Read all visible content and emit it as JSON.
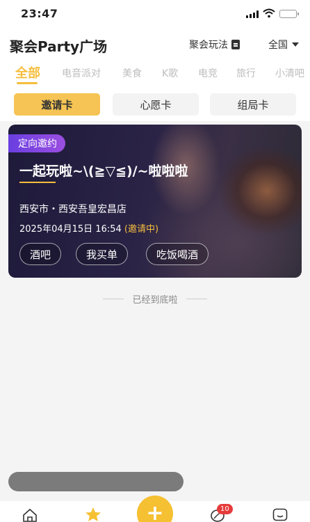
{
  "status_bar": {
    "time": "23:47"
  },
  "header": {
    "title": "聚会Party广场",
    "play_label": "聚会玩法",
    "play_icon": "document-icon",
    "region": "全国"
  },
  "categories": [
    "全部",
    "电音派对",
    "美食",
    "K歌",
    "电竞",
    "旅行",
    "小清吧"
  ],
  "selected_category": "全部",
  "card_tabs": [
    "邀请卡",
    "心愿卡",
    "组局卡"
  ],
  "selected_card_tab": "邀请卡",
  "event": {
    "tag": "定向邀约",
    "title": "一起玩啦~\\(≧▽≦)/~啦啦啦",
    "location": "西安市・西安吾皇宏昌店",
    "datetime": "2025年04月15日 16:54",
    "status": "(邀请中)",
    "chips": [
      "酒吧",
      "我买单",
      "吃饭喝酒"
    ]
  },
  "end_note": "已经到底啦",
  "tab_bar": {
    "items": [
      "home-icon",
      "star-icon",
      "plus-icon",
      "leaf-icon",
      "message-icon"
    ],
    "plus_label": "+",
    "badge_count": "10"
  },
  "colors": {
    "accent": "#f5be3d",
    "tag_purple": "#6a3ee0",
    "badge_red": "#e63b3b"
  }
}
